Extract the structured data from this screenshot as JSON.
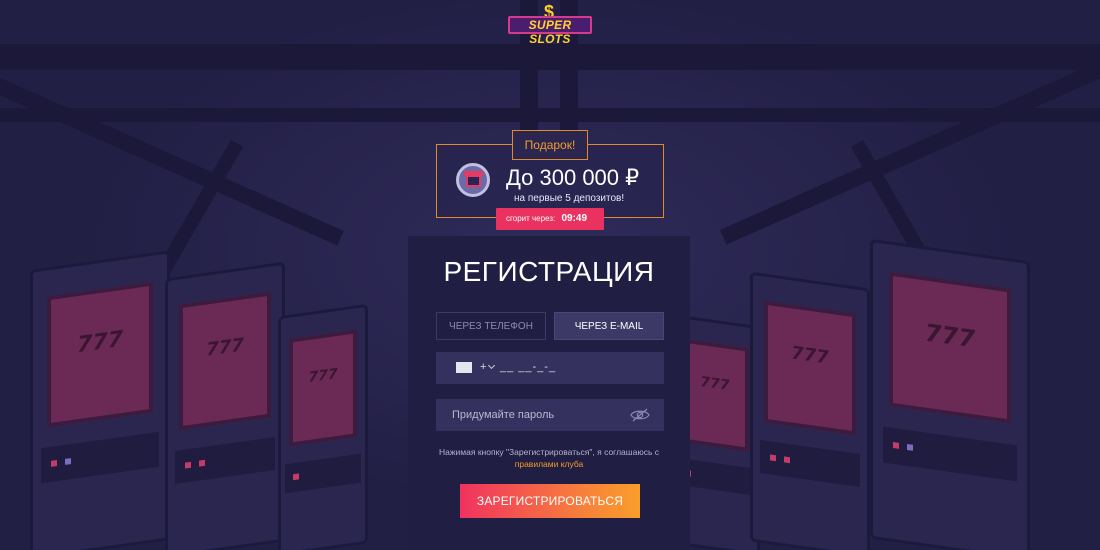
{
  "brand": {
    "logo_text": "SUPER SLOTS"
  },
  "promo": {
    "tag": "Подарок!",
    "amount": "До 300 000 ₽",
    "subtitle": "на первые 5 депозитов!",
    "timer_label": "сгорит через:",
    "timer_value": "09:49"
  },
  "registration": {
    "title": "РЕГИСТРАЦИЯ",
    "tabs": [
      {
        "label": "ЧЕРЕЗ ТЕЛЕФОН",
        "active": false
      },
      {
        "label": "ЧЕРЕЗ E-MAIL",
        "active": true
      }
    ],
    "phone": {
      "prefix": "+",
      "mask": "__ __-_-_"
    },
    "password": {
      "placeholder": "Придумайте пароль"
    },
    "terms_text": "Нажимая кнопку \"Зарегистрироваться\", я соглашаюсь с",
    "terms_link": "правилами клуба",
    "submit_label": "ЗАРЕГИСТРИРОВАТЬСЯ"
  },
  "colors": {
    "accent": "#f19b2c",
    "cta_start": "#f0325f",
    "cta_end": "#f99e2b",
    "background": "#221f45"
  }
}
